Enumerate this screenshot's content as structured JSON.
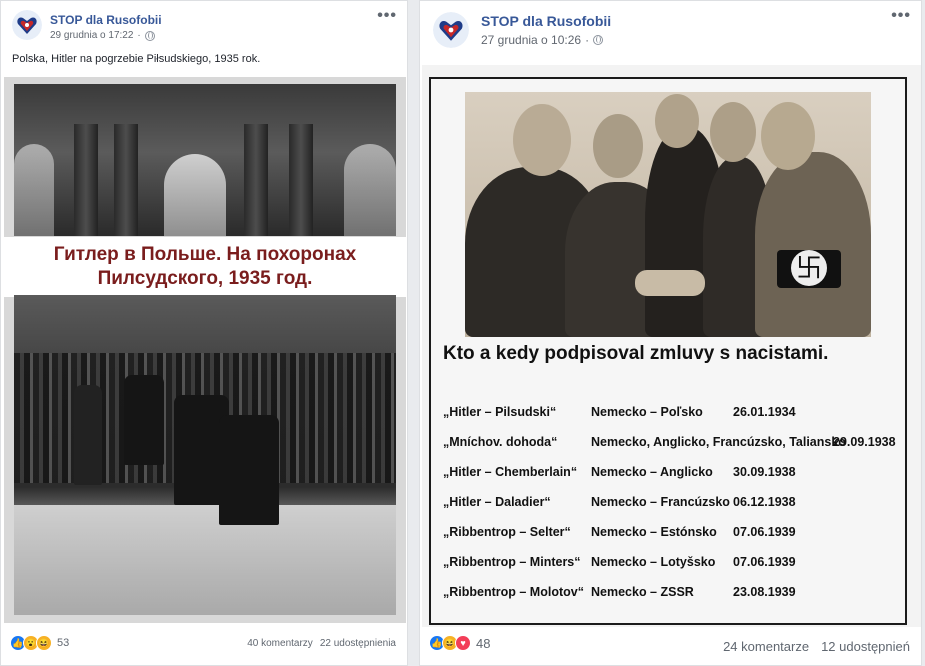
{
  "post_left": {
    "page_name": "STOP dla Rusofobii",
    "timestamp": "29 grudnia o 17:22",
    "more": "•••",
    "text": "Polska, Hitler na pogrzebie Piłsudskiego, 1935 rok.",
    "image": {
      "caption_line1": "Гитлер в Польше. На похоронах",
      "caption_line2": "Пилсудского, 1935 год."
    },
    "reactions": {
      "icons": [
        "like",
        "wow",
        "haha"
      ],
      "count": "53"
    },
    "comments": "40 komentarzy",
    "shares": "22 udostępnienia"
  },
  "post_right": {
    "page_name": "STOP dla Rusofobii",
    "timestamp": "27 grudnia o 10:26",
    "more": "•••",
    "image": {
      "title": "Kto a kedy podpisoval zmluvy s nacistami.",
      "rows": [
        {
          "pact": "„Hitler – Pilsudski“",
          "countries": "Nemecko – Poľsko",
          "date": "26.01.1934"
        },
        {
          "pact": "„Mníchov. dohoda“",
          "countries": "Nemecko, Anglicko, Francúzsko, Taliansko",
          "date": "29.09.1938"
        },
        {
          "pact": "„Hitler – Chemberlain“",
          "countries": "Nemecko – Anglicko",
          "date": "30.09.1938"
        },
        {
          "pact": "„Hitler – Daladier“",
          "countries": "Nemecko – Francúzsko",
          "date": "06.12.1938"
        },
        {
          "pact": "„Ribbentrop – Selter“",
          "countries": "Nemecko – Estónsko",
          "date": "07.06.1939"
        },
        {
          "pact": "„Ribbentrop – Minters“",
          "countries": "Nemecko – Lotyšsko",
          "date": "07.06.1939"
        },
        {
          "pact": "„Ribbentrop – Molotov“",
          "countries": "Nemecko – ZSSR",
          "date": "23.08.1939"
        }
      ]
    },
    "reactions": {
      "icons": [
        "like",
        "haha",
        "love"
      ],
      "count": "48"
    },
    "comments": "24 komentarze",
    "shares": "12 udostępnień"
  },
  "colors": {
    "link": "#385898",
    "caption_red": "#7a1d1d",
    "like_blue": "#1877f2",
    "love_red": "#f33e58",
    "haha_yellow": "#f7b125"
  }
}
